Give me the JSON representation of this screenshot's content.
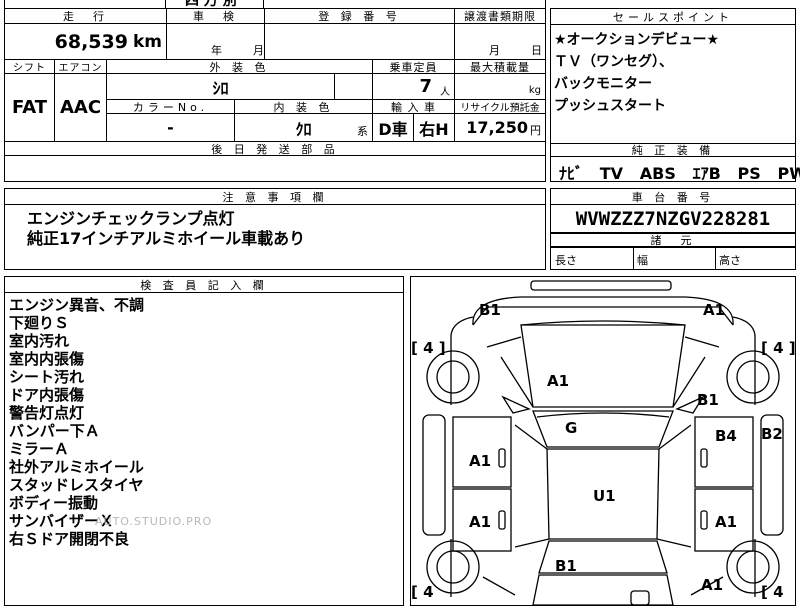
{
  "top_partial_text": "四 万 別",
  "mileage": {
    "header": "走　行",
    "value": "68,539",
    "unit": "km"
  },
  "inspection": {
    "header": "車　検",
    "year_label": "年",
    "month_label": "月"
  },
  "registration": {
    "header": "登 録 番 号",
    "value": ""
  },
  "transfer": {
    "header": "譲渡書類期限",
    "month_label": "月",
    "day_label": "日"
  },
  "shift": {
    "header": "シフト",
    "value": "FAT"
  },
  "aircon": {
    "header": "エアコン",
    "value": "AAC"
  },
  "exterior_color": {
    "header": "外 装 色",
    "value": "ｼﾛ"
  },
  "capacity": {
    "header": "乗車定員",
    "value": "7",
    "unit": "人"
  },
  "max_load": {
    "header": "最大積載量",
    "value": "",
    "unit": "kg"
  },
  "color_no": {
    "header": "カラーNo.",
    "value": "-"
  },
  "interior_color": {
    "header": "内 装 色",
    "value": "ｸﾛ",
    "suffix": "系"
  },
  "import": {
    "header": "輸 入 車",
    "value1": "D車",
    "value2": "右H"
  },
  "recycle": {
    "header": "リサイクル預託金",
    "value": "17,250",
    "unit": "円"
  },
  "later_parts": {
    "header": "後 日 発 送 部 品",
    "value": ""
  },
  "sales_points": {
    "header": "セールスポイント",
    "lines": [
      "★オークションデビュー★",
      "ＴＶ（ワンセグ）、",
      "バックモニター",
      "プッシュスタート"
    ]
  },
  "equipment": {
    "header": "純 正 装 備",
    "items": [
      "ﾅﾋﾞ",
      "TV",
      "ABS",
      "ｴｱB",
      "PS",
      "PW"
    ]
  },
  "notes": {
    "header": "注 意 事 項 欄",
    "lines": [
      "エンジンチェックランプ点灯",
      "純正17インチアルミホイール車載あり"
    ]
  },
  "chassis": {
    "header": "車 台 番 号",
    "value": "WVWZZZ7NZGV228281"
  },
  "dimensions": {
    "header": "諸　元",
    "length": "長さ",
    "width": "幅",
    "height": "高さ"
  },
  "inspector": {
    "header": "検 査 員 記 入 欄",
    "lines": [
      "エンジン異音、不調",
      "下廻りＳ",
      "室内汚れ",
      "室内内張傷",
      "シート汚れ",
      "ドア内張傷",
      "警告灯点灯",
      "バンパー下Ａ",
      "ミラーＡ",
      "社外アルミホイール",
      "スタッドレスタイヤ",
      "ボディー振動",
      "サンバイザーＸ",
      "右Ｓドア開閉不良"
    ]
  },
  "watermark": "AUTO.STUDIO.PRO",
  "diagram": {
    "tire_marks": [
      "[ 4 ]",
      "[ 4 ]",
      "[ 4",
      "[ 4"
    ],
    "damage": {
      "front_left": "B1",
      "front_right": "A1",
      "hood": "A1",
      "fender_right": "B1",
      "windshield": "G",
      "door_fl": "A1",
      "door_fr": "B4",
      "right_side": "B2",
      "roof": "U1",
      "door_rl": "A1",
      "door_rr": "A1",
      "tailgate": "B1",
      "rear_right": "A1"
    }
  }
}
